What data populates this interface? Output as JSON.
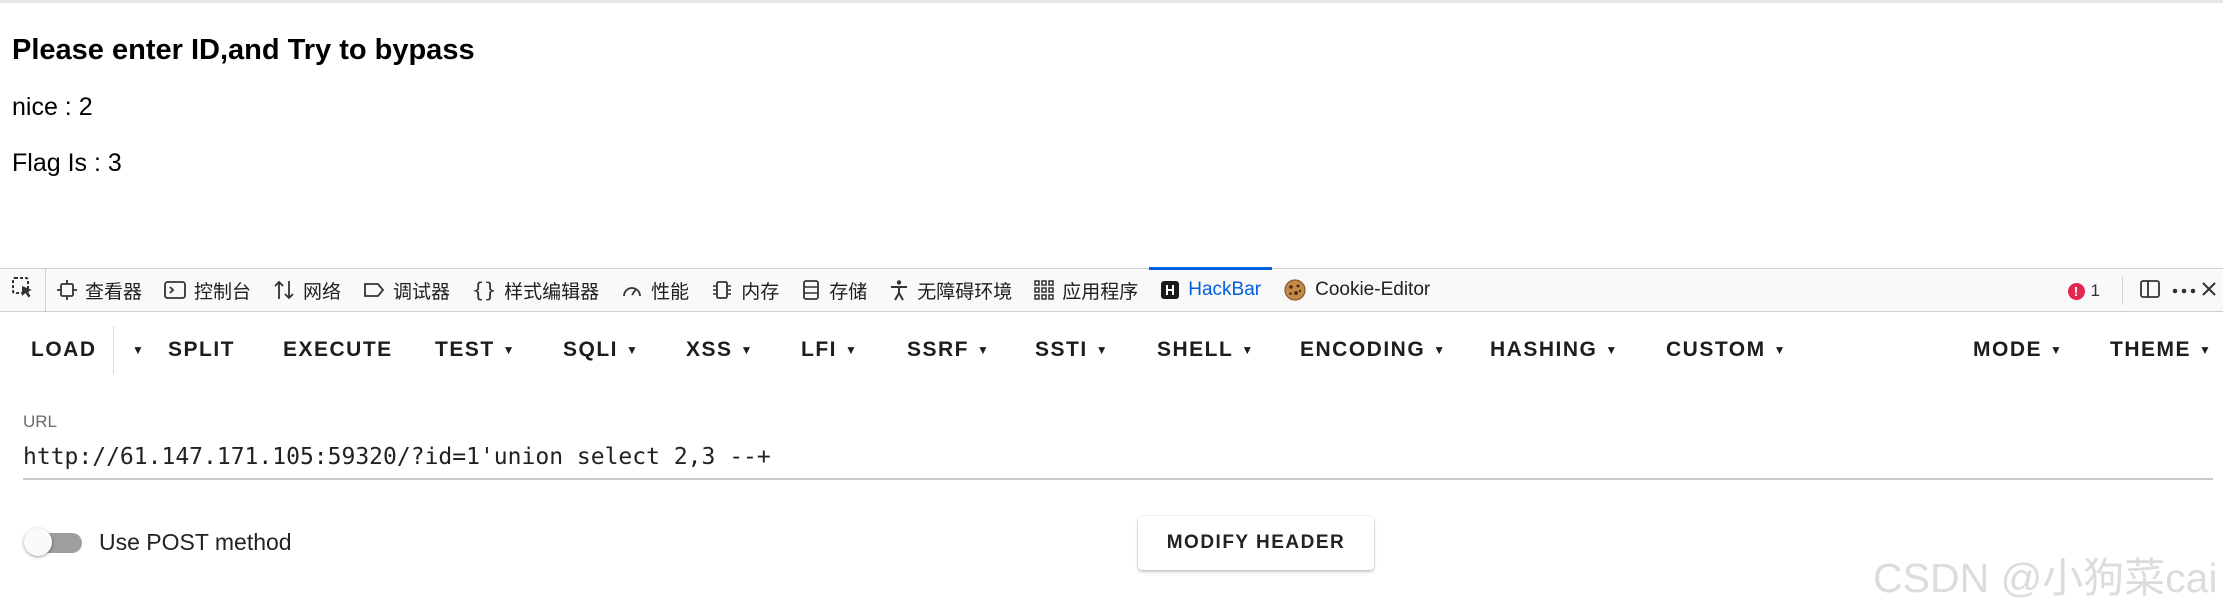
{
  "page": {
    "heading": "Please enter ID,and Try to bypass",
    "nice_line": "nice : 2",
    "flag_line": "Flag Is : 3"
  },
  "devtools": {
    "tabs": [
      {
        "label": "查看器",
        "icon": "inspector-icon"
      },
      {
        "label": "控制台",
        "icon": "console-icon"
      },
      {
        "label": "网络",
        "icon": "network-arrows-icon"
      },
      {
        "label": "调试器",
        "icon": "debugger-icon"
      },
      {
        "label": "样式编辑器",
        "icon": "braces-icon"
      },
      {
        "label": "性能",
        "icon": "performance-gauge-icon"
      },
      {
        "label": "内存",
        "icon": "memory-chip-icon"
      },
      {
        "label": "存储",
        "icon": "storage-icon"
      },
      {
        "label": "无障碍环境",
        "icon": "accessibility-icon"
      },
      {
        "label": "应用程序",
        "icon": "app-grid-icon"
      },
      {
        "label": "HackBar",
        "icon": "hackbar-icon",
        "active": true
      },
      {
        "label": "Cookie-Editor",
        "icon": "cookie-icon"
      }
    ],
    "error_count": "1",
    "error_icon_glyph": "!"
  },
  "hackbar": {
    "menu": {
      "load": "LOAD",
      "split": "SPLIT",
      "execute": "EXECUTE",
      "test": "TEST",
      "sqli": "SQLI",
      "xss": "XSS",
      "lfi": "LFI",
      "ssrf": "SSRF",
      "ssti": "SSTI",
      "shell": "SHELL",
      "encoding": "ENCODING",
      "hashing": "HASHING",
      "custom": "CUSTOM",
      "mode": "MODE",
      "theme": "THEME"
    },
    "url_label": "URL",
    "url_value": "http://61.147.171.105:59320/?id=1'union select 2,3 --+",
    "post_label": "Use POST method",
    "post_enabled": false,
    "modify_header": "MODIFY HEADER"
  },
  "watermark": "CSDN @小狗菜cai",
  "colors": {
    "accent": "#0060df",
    "error": "#e22850",
    "toggle_track": "#9e9e9e"
  }
}
